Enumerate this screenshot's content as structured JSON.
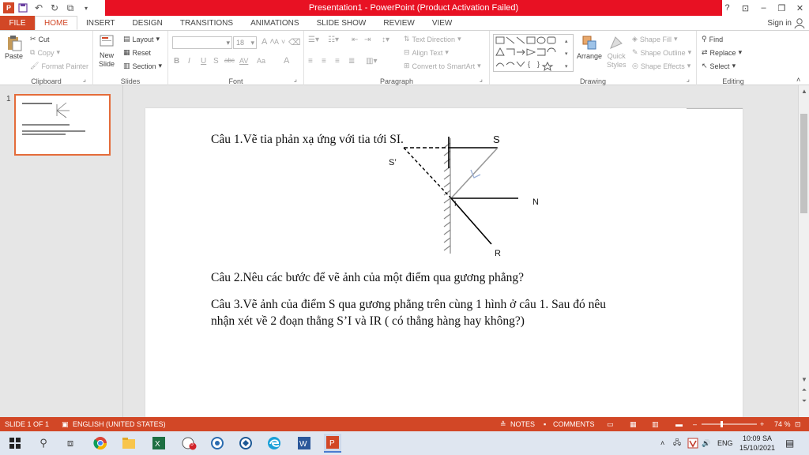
{
  "window": {
    "title": "Presentation1 - PowerPoint (Product Activation Failed)",
    "controls": {
      "help": "?",
      "restore_ribbon": "⊡",
      "minimize": "–",
      "maximize": "❐",
      "close": "✕"
    }
  },
  "tabs": [
    {
      "label": "FILE"
    },
    {
      "label": "HOME"
    },
    {
      "label": "INSERT"
    },
    {
      "label": "DESIGN"
    },
    {
      "label": "TRANSITIONS"
    },
    {
      "label": "ANIMATIONS"
    },
    {
      "label": "SLIDE SHOW"
    },
    {
      "label": "REVIEW"
    },
    {
      "label": "VIEW"
    }
  ],
  "signin": "Sign in",
  "ribbon": {
    "clipboard": {
      "label": "Clipboard",
      "paste": "Paste",
      "cut": "Cut",
      "copy": "Copy",
      "format_painter": "Format Painter"
    },
    "slides": {
      "label": "Slides",
      "new_slide_1": "New",
      "new_slide_2": "Slide",
      "layout": "Layout",
      "reset": "Reset",
      "section": "Section"
    },
    "font": {
      "label": "Font",
      "size": "18",
      "bold": "B",
      "italic": "I",
      "underline": "U",
      "shadow": "S",
      "strike": "abc",
      "spacing": "AV",
      "case": "Aa",
      "color": "A",
      "grow": "A",
      "shrink": "A"
    },
    "paragraph": {
      "label": "Paragraph",
      "text_direction": "Text Direction",
      "align_text": "Align Text",
      "convert_smartart": "Convert to SmartArt"
    },
    "drawing": {
      "label": "Drawing",
      "arrange": "Arrange",
      "quick_styles_1": "Quick",
      "quick_styles_2": "Styles",
      "shape_fill": "Shape Fill",
      "shape_outline": "Shape Outline",
      "shape_effects": "Shape Effects"
    },
    "editing": {
      "label": "Editing",
      "find": "Find",
      "replace": "Replace",
      "select": "Select"
    }
  },
  "thumbnail": {
    "number": "1"
  },
  "slide": {
    "q1": "Câu 1.Vẽ tia phản xạ ứng với tia tới SI.",
    "q2": "Câu 2.Nêu các bước để vẽ ảnh của một điểm qua gương phẳng?",
    "q3_line1": "Câu 3.Vẽ ảnh của điểm S qua gương phẳng trên cùng 1 hình ở câu 1. Sau đó nêu",
    "q3_line2": "nhận xét về 2 đoạn thẳng S’I và IR ( có thẳng hàng hay không?)",
    "labels": {
      "s": "S",
      "s_prime": "S’",
      "n": "N",
      "i": "I",
      "r": "R"
    }
  },
  "statusbar": {
    "slide_count": "SLIDE 1 OF 1",
    "language": "ENGLISH (UNITED STATES)",
    "notes": "NOTES",
    "comments": "COMMENTS",
    "zoom": "74 %"
  },
  "taskbar": {
    "lang": "ENG",
    "time": "10:09 SA",
    "date": "15/10/2021",
    "badge": "5"
  },
  "colors": {
    "accent": "#d24726",
    "titlebar_alert": "#e81123",
    "thumb_border": "#e46c3a"
  }
}
